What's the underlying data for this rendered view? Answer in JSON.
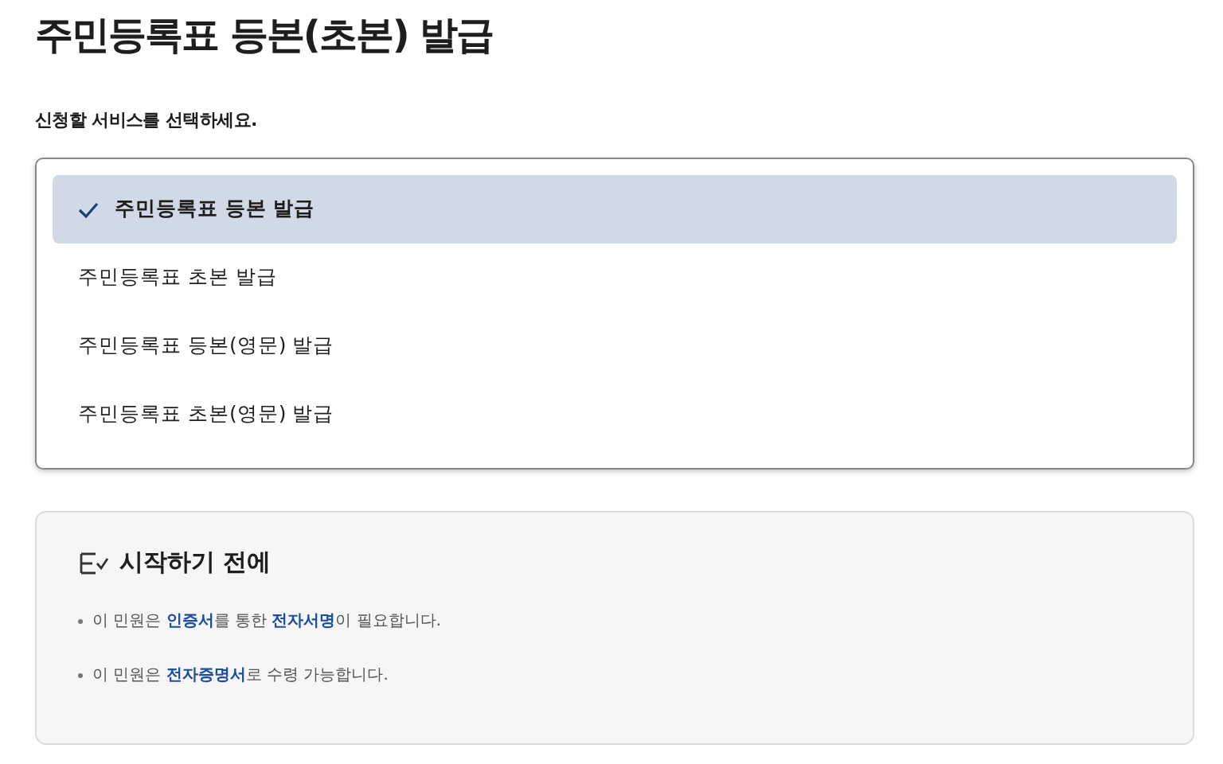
{
  "title": "주민등록표 등본(초본) 발급",
  "prompt": "신청할 서비스를 선택하세요.",
  "options": [
    {
      "label": "주민등록표 등본 발급",
      "selected": true
    },
    {
      "label": "주민등록표 초본 발급",
      "selected": false
    },
    {
      "label": "주민등록표 등본(영문) 발급",
      "selected": false
    },
    {
      "label": "주민등록표 초본(영문) 발급",
      "selected": false
    }
  ],
  "notice": {
    "heading": "시작하기 전에",
    "items": [
      "이 민원은 **인증서**를 통한 **전자서명**이 필요합니다.",
      "이 민원은 **전자증명서**로 수령 가능합니다."
    ]
  }
}
